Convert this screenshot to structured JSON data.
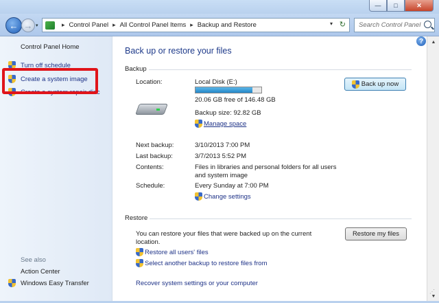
{
  "window": {
    "min_label": "—",
    "max_label": "□",
    "close_label": "✕"
  },
  "address": {
    "crumbs": [
      "Control Panel",
      "All Control Panel Items",
      "Backup and Restore"
    ]
  },
  "search": {
    "placeholder": "Search Control Panel"
  },
  "sidebar": {
    "home": "Control Panel Home",
    "items": [
      {
        "label": "Turn off schedule",
        "icon": "shield-icon"
      },
      {
        "label": "Create a system image",
        "icon": "shield-icon"
      },
      {
        "label": "Create a system repair disc",
        "icon": "shield-icon"
      }
    ],
    "see_also": "See also",
    "see_also_items": [
      {
        "label": "Action Center"
      },
      {
        "label": "Windows Easy Transfer",
        "icon": "shield-icon"
      }
    ]
  },
  "main": {
    "title": "Back up or restore your files",
    "backup": {
      "section": "Backup",
      "location_label": "Location:",
      "location_value": "Local Disk (E:)",
      "usage_fraction": 0.86,
      "free_text": "20.06 GB free of 146.48 GB",
      "size_text": "Backup size: 92.82 GB",
      "manage_link": "Manage space",
      "back_up_now": "Back up now",
      "next_label": "Next backup:",
      "next_value": "3/10/2013 7:00 PM",
      "last_label": "Last backup:",
      "last_value": "3/7/2013 5:52 PM",
      "contents_label": "Contents:",
      "contents_value_1": "Files in libraries and personal folders for all users",
      "contents_value_2": "and system image",
      "schedule_label": "Schedule:",
      "schedule_value": "Every Sunday at 7:00 PM",
      "change_link": "Change settings"
    },
    "restore": {
      "section": "Restore",
      "text_1": "You can restore your files that were backed up on the current",
      "text_2": "location.",
      "restore_my_files": "Restore my files",
      "restore_all": "Restore all users' files",
      "select_another": "Select another backup to restore files from",
      "recover_link": "Recover system settings or your computer"
    }
  },
  "help_label": "?"
}
